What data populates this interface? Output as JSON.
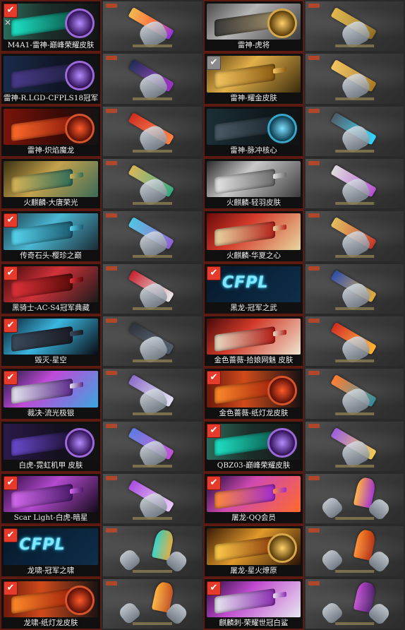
{
  "rows": [
    {
      "left": {
        "label": "M4A1-雷神-巅峰荣耀皮肤",
        "checked": true,
        "check_style": "red",
        "show_close": true,
        "art": "linear-gradient(90deg,#2b6b5c 0%,#1c2f2a 45%,#141414 100%)",
        "weapon": "linear-gradient(90deg,#1ee3c6,#0b5e4f)",
        "emblem": "purple"
      },
      "left_preview": {
        "gun": "linear-gradient(90deg,#f0b94d,#ff6a2f,#8a2be2)",
        "knife": false
      },
      "right": {
        "label": "雷神-虎将",
        "checked": false,
        "check_style": "none",
        "show_close": false,
        "art": "linear-gradient(135deg,#4a4a4a 0%,#b6b6b6 40%,#3c3c3c 100%)",
        "weapon": "linear-gradient(90deg,#3a3a3a,#9a8a66)",
        "emblem": "gold"
      },
      "right_preview": {
        "gun": "linear-gradient(90deg,#e2b64a,#8a6a1c)",
        "knife": false
      }
    },
    {
      "left": {
        "label": "雷神-R.LGD-CFPLS18冠军",
        "checked": false,
        "check_style": "none",
        "show_close": false,
        "art": "linear-gradient(90deg,#1c2a4a 0%,#0f1626 60%,#111 100%)",
        "weapon": "linear-gradient(90deg,#4a3a8a,#1f2244)",
        "emblem": "purple"
      },
      "left_preview": {
        "gun": "linear-gradient(90deg,#1d2a54,#9a2ac4)",
        "knife": false
      },
      "right": {
        "label": "雷神-耀金皮肤",
        "checked": true,
        "check_style": "gray",
        "show_close": false,
        "art": "linear-gradient(135deg,#5a3d10 0%,#e2b04a 40%,#3a2a0a 100%)",
        "weapon": "linear-gradient(90deg,#f5c760,#8a5a12)",
        "emblem": "none"
      },
      "right_preview": {
        "gun": "linear-gradient(90deg,#f3c35c,#a57418)",
        "knife": false
      }
    },
    {
      "left": {
        "label": "雷神-炽焰魔龙",
        "checked": false,
        "check_style": "none",
        "show_close": false,
        "art": "linear-gradient(90deg,#7a150b 0%,#3a0a06 60%,#141414 100%)",
        "weapon": "linear-gradient(90deg,#ff6a2a,#8a1a0a)",
        "emblem": "red"
      },
      "left_preview": {
        "gun": "linear-gradient(90deg,#d02a1c,#ff7a3a)",
        "knife": false
      },
      "right": {
        "label": "雷神-脉冲核心",
        "checked": false,
        "check_style": "none",
        "show_close": false,
        "art": "linear-gradient(90deg,#1b2f36 0%,#0f1a1e 60%,#121212 100%)",
        "weapon": "linear-gradient(90deg,#4a5a66,#1d2830)",
        "emblem": "cyan"
      },
      "right_preview": {
        "gun": "linear-gradient(90deg,#4a5a66,#2ad4ff)",
        "knife": false
      }
    },
    {
      "left": {
        "label": "火麒麟-大唐荣光",
        "checked": false,
        "check_style": "none",
        "show_close": false,
        "art": "linear-gradient(135deg,#3a3012 0%,#c4a24c 45%,#3a6a58 100%)",
        "weapon": "linear-gradient(90deg,#d8b455,#2e6d5a)",
        "emblem": "none"
      },
      "left_preview": {
        "gun": "linear-gradient(90deg,#d8b455,#2ea67a)",
        "knife": false
      },
      "right": {
        "label": "火麒麟-轻羽皮肤",
        "checked": false,
        "check_style": "none",
        "show_close": false,
        "art": "linear-gradient(135deg,#2a2a2a 0%,#c9c9c9 40%,#3a3a3a 100%)",
        "weapon": "linear-gradient(90deg,#e6e6e6,#6a6a6a)",
        "emblem": "none"
      },
      "right_preview": {
        "gun": "linear-gradient(90deg,#dcdcdc,#b44ad0)",
        "knife": false
      }
    },
    {
      "left": {
        "label": "传奇石头-樱珍之巅",
        "checked": true,
        "check_style": "red",
        "show_close": false,
        "art": "linear-gradient(135deg,#1a3a4a 0%,#4bb7d2 45%,#1a2a34 100%)",
        "weapon": "linear-gradient(90deg,#57d6f0,#1c5a70)",
        "emblem": "none"
      },
      "left_preview": {
        "gun": "linear-gradient(90deg,#4bc5e0,#8a5ad0)",
        "knife": false
      },
      "right": {
        "label": "火麒麟-华夏之心",
        "checked": false,
        "check_style": "none",
        "show_close": false,
        "art": "linear-gradient(135deg,#6a0a0a 0%,#d43a2a 40%,#e8d7a0 100%)",
        "weapon": "linear-gradient(90deg,#e9d8a3,#b3221a)",
        "emblem": "none"
      },
      "right_preview": {
        "gun": "linear-gradient(90deg,#e2bf5a,#c23020)",
        "knife": false
      }
    },
    {
      "left": {
        "label": "黑骑士-AC-S4冠军典藏",
        "checked": true,
        "check_style": "red",
        "show_close": false,
        "art": "linear-gradient(135deg,#3a0a0a 0%,#d2323a 45%,#1a1a1a 100%)",
        "weapon": "linear-gradient(90deg,#e0323a,#5a0a0a)",
        "emblem": "none"
      },
      "left_preview": {
        "gun": "linear-gradient(90deg,#c81e2a,#e8e8e8)",
        "knife": false
      },
      "right": {
        "label": "黑龙-冠军之武",
        "checked": true,
        "check_style": "red",
        "show_close": false,
        "art": "linear-gradient(135deg,#06182a 0%,#0e2e4a 100%)",
        "weapon": "linear-gradient(90deg,#0e2e4a,#0e2e4a)",
        "emblem": "none",
        "cpl": "CFPL"
      },
      "right_preview": {
        "gun": "linear-gradient(90deg,#2a4aa8,#e0a838)",
        "knife": false
      }
    },
    {
      "left": {
        "label": "毁灭-星空",
        "checked": true,
        "check_style": "red",
        "show_close": false,
        "art": "linear-gradient(135deg,#0a1a2a 0%,#3ab7e0 45%,#0a0a14 100%)",
        "weapon": "linear-gradient(90deg,#3a4a5a,#1a1a24)",
        "emblem": "none"
      },
      "left_preview": {
        "gun": "linear-gradient(90deg,#2a2f38,#4a5664)",
        "knife": false
      },
      "right": {
        "label": "金色蔷薇-拾娘网魅 皮肤",
        "checked": false,
        "check_style": "none",
        "show_close": false,
        "art": "linear-gradient(135deg,#4a0a0a 0%,#d23a2a 40%,#f0e6d0 100%)",
        "weapon": "linear-gradient(90deg,#e8dcc4,#b01a14)",
        "emblem": "none"
      },
      "right_preview": {
        "gun": "linear-gradient(90deg,#d42a1c,#ffb02a)",
        "knife": false
      }
    },
    {
      "left": {
        "label": "裁决-流光极银",
        "checked": true,
        "check_style": "red",
        "show_close": false,
        "art": "linear-gradient(135deg,#1a1a3a 0%,#c04ad8 40%,#3aa7e0 100%)",
        "weapon": "linear-gradient(90deg,#e6e6f0,#5a2a8a)",
        "emblem": "none"
      },
      "left_preview": {
        "gun": "linear-gradient(90deg,#8a6ac8,#e0e0f0)",
        "knife": false
      },
      "right": {
        "label": "金色蔷薇-纸灯龙皮肤",
        "checked": true,
        "check_style": "red",
        "show_close": false,
        "art": "linear-gradient(90deg,#6a1a0a 0%,#d04a1a 40%,#1a1212 100%)",
        "weapon": "linear-gradient(90deg,#ff8a2a,#a0200a)",
        "emblem": "red"
      },
      "right_preview": {
        "gun": "linear-gradient(90deg,#ff7a2a,#2a8a9a)",
        "knife": false
      }
    },
    {
      "left": {
        "label": "白虎-霓虹机甲 皮肤",
        "checked": false,
        "check_style": "none",
        "show_close": false,
        "art": "linear-gradient(90deg,#2a1a4a 0%,#14101e 60%,#121212 100%)",
        "weapon": "linear-gradient(90deg,#6a4ad0,#1a1030)",
        "emblem": "purple"
      },
      "left_preview": {
        "gun": "linear-gradient(90deg,#5a7ae0,#c04ad8)",
        "knife": false
      },
      "right": {
        "label": "QBZ03-巅峰荣耀皮肤",
        "checked": true,
        "check_style": "red",
        "show_close": false,
        "art": "linear-gradient(90deg,#2b6b5c 0%,#1c2f2a 45%,#141414 100%)",
        "weapon": "linear-gradient(90deg,#1ee3c6,#0b5e4f)",
        "emblem": "purple"
      },
      "right_preview": {
        "gun": "linear-gradient(90deg,#9a5ae0,#f0c84a)",
        "knife": false
      }
    },
    {
      "left": {
        "label": "Scar Light-白虎-暗星",
        "checked": true,
        "check_style": "red",
        "show_close": false,
        "art": "linear-gradient(135deg,#2a0a3a 0%,#b44ad0 45%,#140a1a 100%)",
        "weapon": "linear-gradient(90deg,#d66af0,#4a1a6a)",
        "emblem": "none"
      },
      "left_preview": {
        "gun": "linear-gradient(90deg,#a84ae0,#e8c8f8)",
        "knife": false
      },
      "right": {
        "label": "屠龙-QQ会员",
        "checked": true,
        "check_style": "red",
        "show_close": false,
        "art": "linear-gradient(135deg,#1a0a3a 0%,#d04ab0 40%,#ff6a2a 100%)",
        "weapon": "linear-gradient(90deg,#ff8a3a,#a02ad0)",
        "emblem": "none"
      },
      "right_preview": {
        "gun": "linear-gradient(90deg,#ffb03a,#a02ad0)",
        "knife": true
      }
    },
    {
      "left": {
        "label": "龙啸-冠军之啸",
        "checked": true,
        "check_style": "red",
        "show_close": false,
        "art": "linear-gradient(135deg,#06182a 0%,#0e2e4a 100%)",
        "weapon": "linear-gradient(90deg,#0e2e4a,#0e2e4a)",
        "emblem": "none",
        "cpl": "CFPL"
      },
      "left_preview": {
        "gun": "linear-gradient(90deg,#2ad0c8,#e0a838)",
        "knife": true
      },
      "right": {
        "label": "屠龙-星火燎原",
        "checked": false,
        "check_style": "none",
        "show_close": false,
        "art": "linear-gradient(135deg,#3a1a06 0%,#e09a2a 45%,#2a1206 100%)",
        "weapon": "linear-gradient(90deg,#ffcc4a,#8a3a0a)",
        "emblem": "gold"
      },
      "right_preview": {
        "gun": "linear-gradient(90deg,#ff8a2a,#b02a0a)",
        "knife": true
      }
    },
    {
      "left": {
        "label": "龙啸-纸灯龙皮肤",
        "checked": true,
        "check_style": "red",
        "show_close": false,
        "art": "linear-gradient(90deg,#6a1a0a 0%,#d04a1a 40%,#1a1212 100%)",
        "weapon": "linear-gradient(90deg,#ff8a2a,#a0200a)",
        "emblem": "red"
      },
      "left_preview": {
        "gun": "linear-gradient(90deg,#ffb03a,#c04a1a)",
        "knife": true
      },
      "right": {
        "label": "麒麟刺-荣耀世冠白鲨",
        "checked": true,
        "check_style": "red",
        "show_close": false,
        "art": "linear-gradient(135deg,#2a0a3a 0%,#c04ad0 40%,#e8e8f0 100%)",
        "weapon": "linear-gradient(90deg,#e8e8f0,#8a2ab0)",
        "emblem": "none"
      },
      "right_preview": {
        "gun": "linear-gradient(90deg,#c04ad0,#4a1a6a)",
        "knife": true
      }
    }
  ]
}
